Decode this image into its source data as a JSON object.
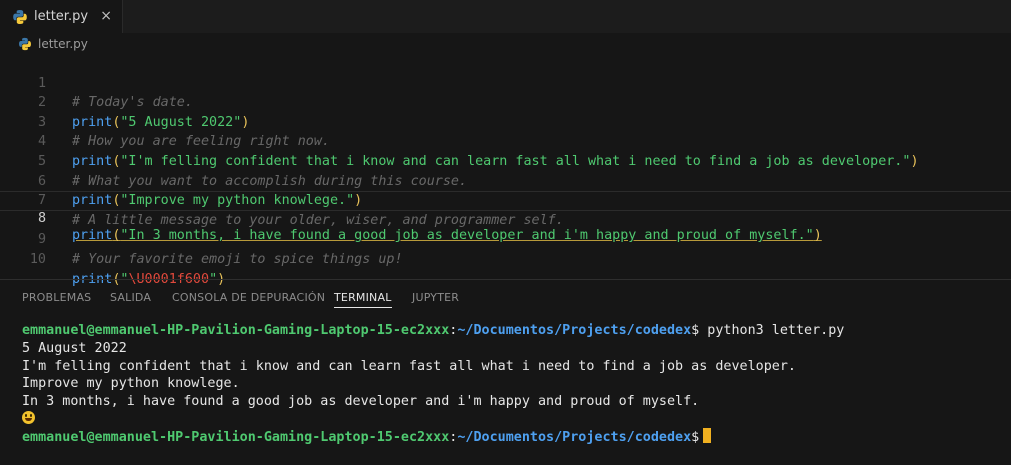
{
  "tab": {
    "label": "letter.py",
    "close_glyph": "×",
    "icon": "python-icon"
  },
  "breadcrumb": {
    "label": "letter.py",
    "icon": "python-icon"
  },
  "editor": {
    "lines": [
      {
        "num": "1",
        "comment": "# Today's date."
      },
      {
        "num": "2",
        "fn": "print",
        "str": "\"5 August 2022\""
      },
      {
        "num": "3",
        "comment": "# How you are feeling right now."
      },
      {
        "num": "4",
        "fn": "print",
        "str": "\"I'm felling confident that i know and can learn fast all what i need to find a job as developer.\""
      },
      {
        "num": "5",
        "comment": "# What you want to accomplish during this course."
      },
      {
        "num": "6",
        "fn": "print",
        "str": "\"Improve my python knowlege.\""
      },
      {
        "num": "7",
        "comment": "# A little message to your older, wiser, and programmer self."
      },
      {
        "num": "8",
        "fn": "print",
        "str": "\"In 3 months, i have found a good job as developer and i'm happy and proud of myself.\""
      },
      {
        "num": "9",
        "comment": "# Your favorite emoji to spice things up!"
      },
      {
        "num": "10",
        "fn": "print",
        "str_open": "\"",
        "escape": "\\U0001f600",
        "str_close": "\""
      }
    ],
    "active_line": "8"
  },
  "panel": {
    "tabs": [
      "PROBLEMAS",
      "SALIDA",
      "CONSOLA DE DEPURACIÓN",
      "TERMINAL",
      "JUPYTER"
    ],
    "active_tab": "TERMINAL"
  },
  "terminal": {
    "user_host": "emmanuel@emmanuel-HP-Pavilion-Gaming-Laptop-15-ec2xxx",
    "colon": ":",
    "path": "~/Documentos/Projects/codedex",
    "prompt_symbol": "$",
    "command": " python3 letter.py",
    "output": [
      "5 August 2022",
      "I'm felling confident that i know and can learn fast all what i need to find a job as developer.",
      "Improve my python knowlege.",
      "In 3 months, i have found a good job as developer and i'm happy and proud of myself."
    ],
    "emoji": "😀"
  },
  "colors": {
    "background": "#161616",
    "keyword": "#4ea0f0",
    "string": "#4fc970",
    "comment": "#686868",
    "escape": "#e0493c",
    "cursor": "#f0b020"
  }
}
